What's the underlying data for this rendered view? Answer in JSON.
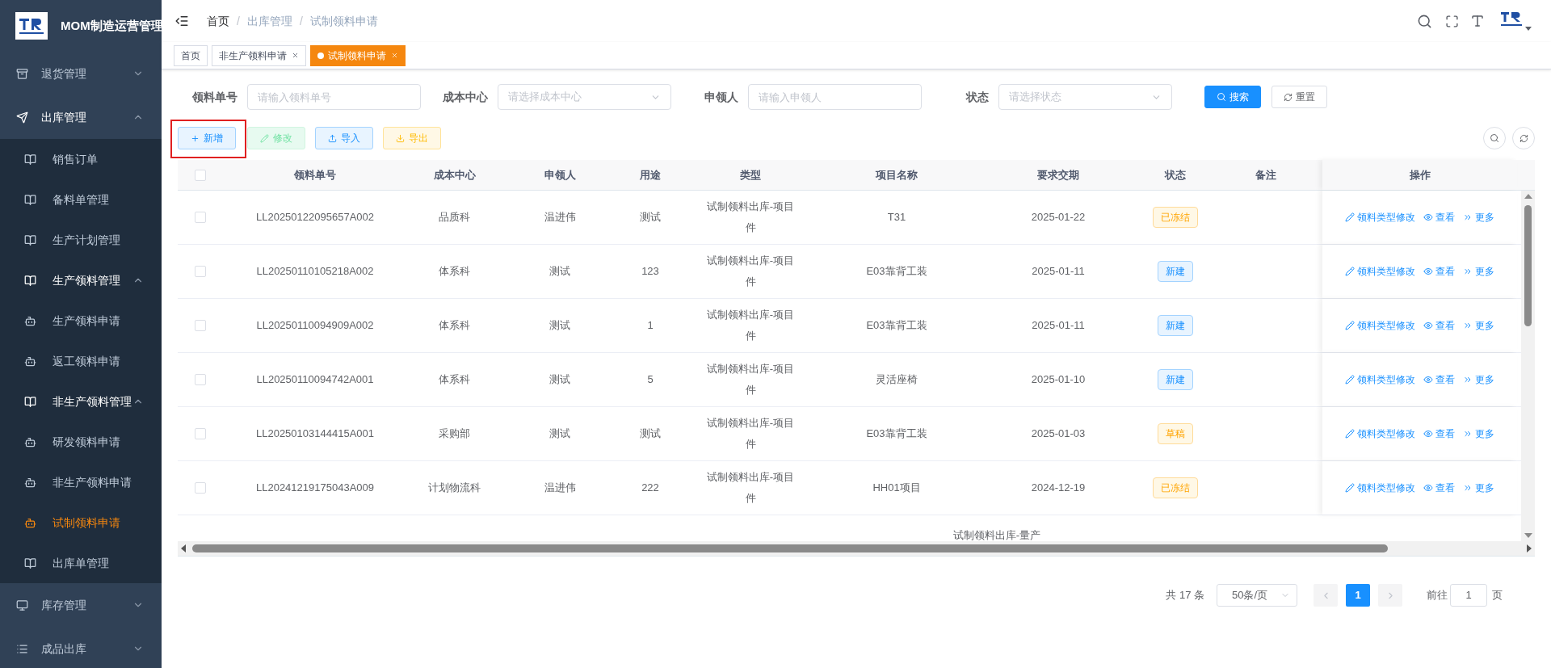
{
  "app": {
    "title": "MOM制造运营管理"
  },
  "sidebar": {
    "items": [
      {
        "label": "退货管理",
        "expanded": false,
        "selected": false
      },
      {
        "label": "出库管理",
        "expanded": true,
        "selected": false,
        "children": [
          {
            "label": "销售订单",
            "selected": false
          },
          {
            "label": "备料单管理",
            "selected": false
          },
          {
            "label": "生产计划管理",
            "selected": false
          },
          {
            "label": "生产领料管理",
            "expanded": true,
            "selected": false,
            "children": [
              {
                "label": "生产领料申请",
                "selected": false
              },
              {
                "label": "返工领料申请",
                "selected": false
              }
            ]
          },
          {
            "label": "非生产领料管理",
            "expanded": true,
            "selected": false,
            "children": [
              {
                "label": "研发领料申请",
                "selected": false
              },
              {
                "label": "非生产领料申请",
                "selected": false
              },
              {
                "label": "试制领料申请",
                "selected": true
              }
            ]
          },
          {
            "label": "出库单管理",
            "selected": false
          }
        ]
      },
      {
        "label": "库存管理",
        "expanded": false,
        "selected": false
      },
      {
        "label": "成品出库",
        "expanded": false,
        "selected": false
      }
    ]
  },
  "breadcrumb": [
    "首页",
    "出库管理",
    "试制领料申请"
  ],
  "breadcrumb_separator": "/",
  "tabs": [
    {
      "label": "首页",
      "closable": false,
      "selected": false
    },
    {
      "label": "非生产领料申请",
      "closable": true,
      "selected": false
    },
    {
      "label": "试制领料申请",
      "closable": true,
      "selected": true
    }
  ],
  "filters": [
    {
      "label": "领料单号",
      "kind": "input",
      "placeholder": "请输入领料单号"
    },
    {
      "label": "成本中心",
      "kind": "select",
      "placeholder": "请选择成本中心"
    },
    {
      "label": "申领人",
      "kind": "input",
      "placeholder": "请输入申领人"
    },
    {
      "label": "状态",
      "kind": "select",
      "placeholder": "请选择状态"
    }
  ],
  "filter_buttons": [
    {
      "label": "搜索",
      "kind": "primary"
    },
    {
      "label": "重置",
      "kind": "plain"
    }
  ],
  "toolbar": [
    {
      "label": "新增",
      "kind": "add",
      "highlighted": true
    },
    {
      "label": "修改",
      "kind": "edit",
      "highlighted": false
    },
    {
      "label": "导入",
      "kind": "import",
      "highlighted": false
    },
    {
      "label": "导出",
      "kind": "export",
      "highlighted": false
    }
  ],
  "table": {
    "select_all_checked": false,
    "columns": [
      "领料单号",
      "成本中心",
      "申领人",
      "用途",
      "类型",
      "项目名称",
      "要求交期",
      "状态",
      "备注",
      "操作"
    ],
    "rows": [
      {
        "checked": false,
        "id": "LL20250122095657A002",
        "cost_center": "品质科",
        "applicant": "温进伟",
        "purpose": "测试",
        "type": "试制领料出库-项目件",
        "project": "T31",
        "due": "2025-01-22",
        "status": {
          "label": "已冻结",
          "kind": "warning"
        },
        "actions": [
          "领料类型修改",
          "查看",
          "更多"
        ]
      },
      {
        "checked": false,
        "id": "LL20250110105218A002",
        "cost_center": "体系科",
        "applicant": "测试",
        "purpose": "123",
        "type": "试制领料出库-项目件",
        "project": "E03靠背工装",
        "due": "2025-01-11",
        "status": {
          "label": "新建",
          "kind": "info"
        },
        "actions": [
          "领料类型修改",
          "查看",
          "更多"
        ]
      },
      {
        "checked": false,
        "id": "LL20250110094909A002",
        "cost_center": "体系科",
        "applicant": "测试",
        "purpose": "1",
        "type": "试制领料出库-项目件",
        "project": "E03靠背工装",
        "due": "2025-01-11",
        "status": {
          "label": "新建",
          "kind": "info"
        },
        "actions": [
          "领料类型修改",
          "查看",
          "更多"
        ]
      },
      {
        "checked": false,
        "id": "LL20250110094742A001",
        "cost_center": "体系科",
        "applicant": "测试",
        "purpose": "5",
        "type": "试制领料出库-项目件",
        "project": "灵活座椅",
        "due": "2025-01-10",
        "status": {
          "label": "新建",
          "kind": "info"
        },
        "actions": [
          "领料类型修改",
          "查看",
          "更多"
        ]
      },
      {
        "checked": false,
        "id": "LL20250103144415A001",
        "cost_center": "采购部",
        "applicant": "测试",
        "purpose": "测试",
        "type": "试制领料出库-项目件",
        "project": "E03靠背工装",
        "due": "2025-01-03",
        "status": {
          "label": "草稿",
          "kind": "warning"
        },
        "actions": [
          "领料类型修改",
          "查看",
          "更多"
        ]
      },
      {
        "checked": false,
        "id": "LL20241219175043A009",
        "cost_center": "计划物流科",
        "applicant": "温进伟",
        "purpose": "222",
        "type": "试制领料出库-项目件",
        "project": "HH01项目",
        "due": "2024-12-19",
        "status": {
          "label": "已冻结",
          "kind": "warning"
        },
        "actions": [
          "领料类型修改",
          "查看",
          "更多"
        ]
      }
    ],
    "partial_row": {
      "type": "试制领料出库-量产"
    }
  },
  "pagination": {
    "total": "共 17 条",
    "page_size": "50条/页",
    "pages": [
      {
        "label": "1",
        "selected": true
      }
    ],
    "goto_label": "前往",
    "goto_value": "1",
    "goto_suffix": "页"
  }
}
